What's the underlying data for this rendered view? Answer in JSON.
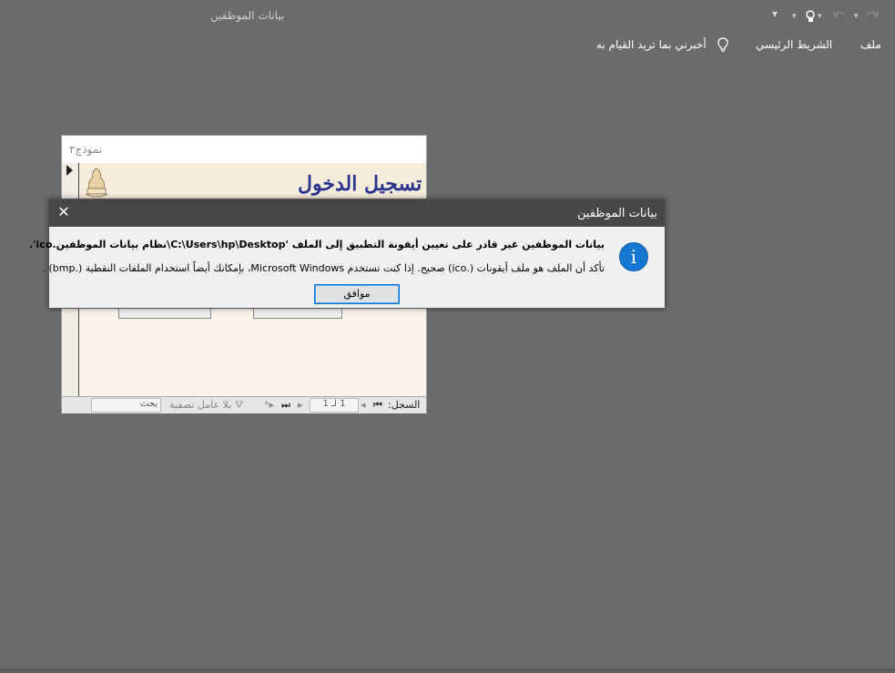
{
  "app": {
    "title": "بيانات الموظفين"
  },
  "quick_access": {
    "customize_icon": "chevron-down-icon",
    "touch_icon": "touch-mode-icon",
    "undo_icon": "undo-icon",
    "redo_icon": "redo-icon"
  },
  "ribbon": {
    "tabs": [
      {
        "label": "ملف"
      },
      {
        "label": "الشريط الرئيسي"
      }
    ],
    "tell_me": "أخبرني بما تريد القيام به",
    "tell_me_icon": "lightbulb-icon"
  },
  "form": {
    "tab_label": "نموذج٢",
    "header_title": "تسجيل الدخول",
    "navbar": {
      "record_label": "السجل:",
      "record_value": "1 لـ 1",
      "filter_label": "بلا عامل تصفية",
      "search_label": "بحث"
    }
  },
  "dialog": {
    "title": "بيانات الموظفين",
    "message_main": "بيانات الموظفين غير قادر على تعيين أيقونة التطبيق إلى الملف 'C:\\Users\\hp\\Desktop\\نظام بيانات الموظفين.ico'.",
    "message_detail": "تأكد أن الملف هو ملف أيقونات (.ico) صحيح. إذا كنت تستخدم Microsoft Windows، بإمكانك أيضاً استخدام الملفات النقطية (.bmp) .",
    "ok_label": "موافق",
    "icon": "info-icon"
  },
  "colors": {
    "background": "#6b6b6b",
    "dialog_title_bar": "#474747",
    "accent": "#0078d7",
    "form_title": "#2b3590"
  }
}
